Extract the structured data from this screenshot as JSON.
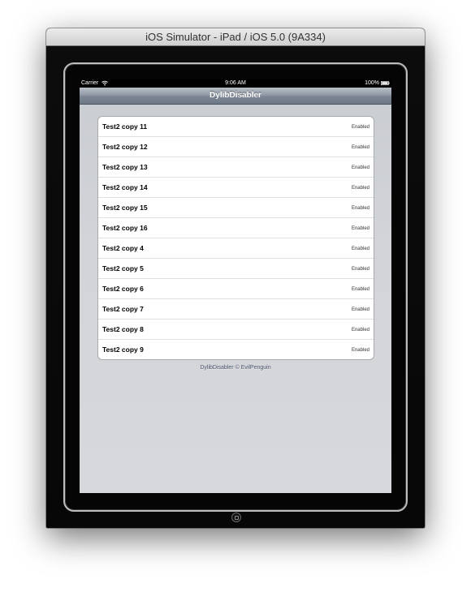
{
  "window": {
    "title": "iOS Simulator - iPad / iOS 5.0 (9A334)"
  },
  "status_bar": {
    "carrier": "Carrier",
    "time": "9:06 AM",
    "battery": "100%"
  },
  "navbar": {
    "title": "DylibDisabler"
  },
  "table": {
    "rows": [
      {
        "title": "Test2 copy 11",
        "status": "Enabled"
      },
      {
        "title": "Test2 copy 12",
        "status": "Enabled"
      },
      {
        "title": "Test2 copy 13",
        "status": "Enabled"
      },
      {
        "title": "Test2 copy 14",
        "status": "Enabled"
      },
      {
        "title": "Test2 copy 15",
        "status": "Enabled"
      },
      {
        "title": "Test2 copy 16",
        "status": "Enabled"
      },
      {
        "title": "Test2 copy 4",
        "status": "Enabled"
      },
      {
        "title": "Test2 copy 5",
        "status": "Enabled"
      },
      {
        "title": "Test2 copy 6",
        "status": "Enabled"
      },
      {
        "title": "Test2 copy 7",
        "status": "Enabled"
      },
      {
        "title": "Test2 copy 8",
        "status": "Enabled"
      },
      {
        "title": "Test2 copy 9",
        "status": "Enabled"
      }
    ]
  },
  "footer": {
    "text": "DylibDisabler © EvilPenguin"
  },
  "icons": [
    "wifi-icon",
    "battery-icon",
    "home-button-icon"
  ]
}
